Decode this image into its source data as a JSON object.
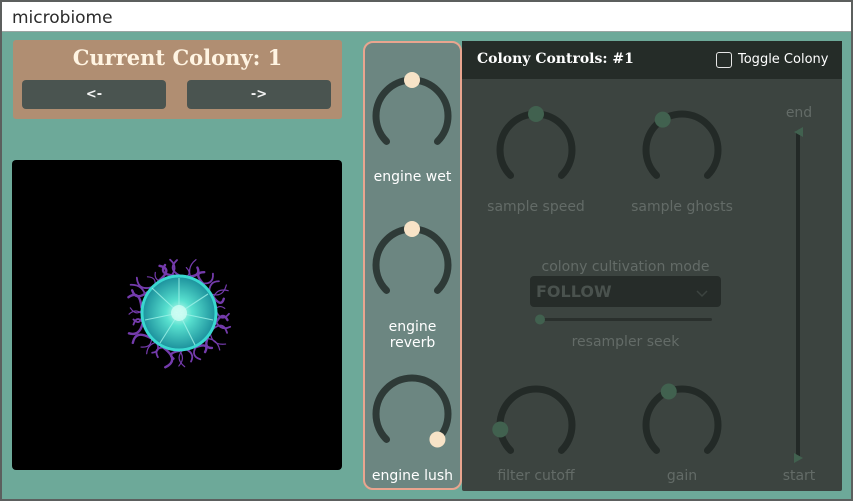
{
  "window": {
    "title": "microbiome"
  },
  "colony_selector": {
    "title": "Current Colony: 1",
    "prev_label": "<-",
    "next_label": "->"
  },
  "engine": {
    "knobs": [
      {
        "label": "engine wet",
        "value": 0.5
      },
      {
        "label": "engine reverb",
        "value": 0.5
      },
      {
        "label": "engine lush",
        "value": 1.0
      }
    ]
  },
  "controls": {
    "title": "Colony Controls: #1",
    "toggle_label": "Toggle Colony",
    "toggle_checked": false,
    "knobs": [
      {
        "label": "sample speed",
        "value": 0.5
      },
      {
        "label": "sample ghosts",
        "value": 0.38
      },
      {
        "label": "filter cutoff",
        "value": 0.14
      },
      {
        "label": "gain",
        "value": 0.42
      }
    ],
    "mode_label": "colony cultivation mode",
    "mode_value": "FOLLOW",
    "seek_label": "resampler seek",
    "seek_value": 0.0,
    "range_end_label": "end",
    "range_start_label": "start"
  },
  "colors": {
    "background": "#6da999",
    "accent": "#f7e3c7",
    "panel_border": "#e9a58f",
    "knob_track_dark": "#2e3a37",
    "knob_thumb_dim": "#41614f",
    "colony_core": "#36c6bb",
    "colony_tendrils": "#7a3fb3"
  }
}
